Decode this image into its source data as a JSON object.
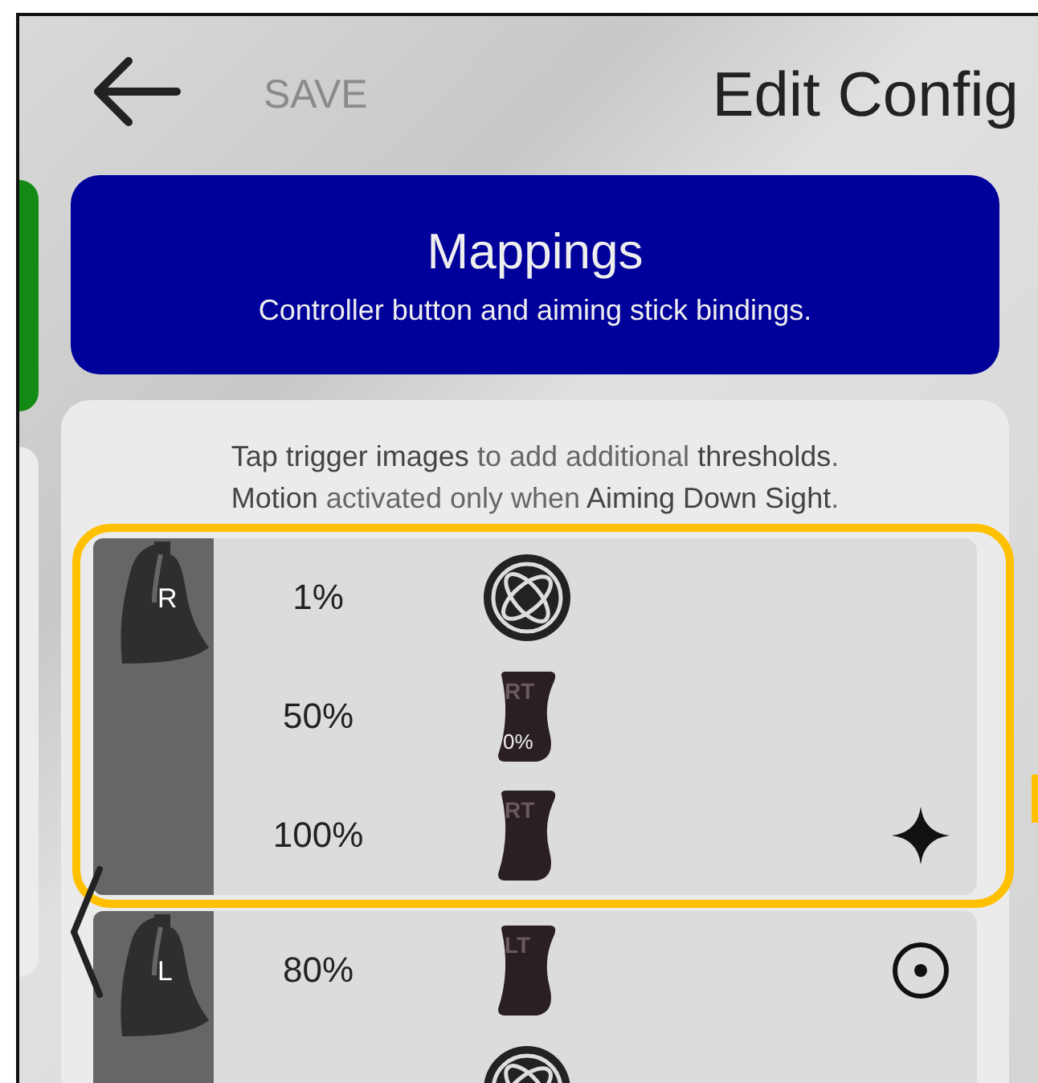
{
  "header": {
    "save": {
      "label": "SAVE",
      "disabled": true
    },
    "title": "Edit Config"
  },
  "banner": {
    "title": "Mappings",
    "subtitle": "Controller button and aiming stick bindings."
  },
  "hint": [
    "**Tap trigger images** to add additional **thresholds**.",
    "**Motion** activated only when **Aiming Down Sight**."
  ],
  "groups": [
    {
      "trigger": "R",
      "highlighted": true,
      "rows": [
        {
          "threshold": "1%",
          "action": {
            "kind": "motion"
          }
        },
        {
          "threshold": "50%",
          "action": {
            "kind": "trigger",
            "label": "RT",
            "sublabel": "0%"
          }
        },
        {
          "threshold": "100%",
          "action": {
            "kind": "trigger",
            "label": "RT"
          },
          "end": {
            "kind": "sparkle"
          }
        }
      ]
    },
    {
      "trigger": "L",
      "highlighted": false,
      "rows": [
        {
          "threshold": "80%",
          "action": {
            "kind": "trigger",
            "label": "LT"
          },
          "end": {
            "kind": "target"
          }
        },
        {
          "action": {
            "kind": "motion"
          }
        }
      ]
    }
  ]
}
